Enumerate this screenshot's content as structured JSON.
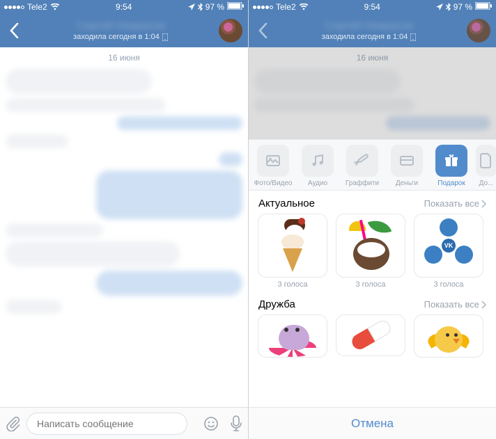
{
  "status": {
    "carrier": "Tele2",
    "time": "9:54",
    "battery": "97 %"
  },
  "header": {
    "name": "Сергей Некрасов",
    "last_seen": "заходила сегодня в 1:04"
  },
  "chat": {
    "date_separator": "16 июня",
    "compose_placeholder": "Написать сообщение"
  },
  "attachments": {
    "items": [
      {
        "key": "photo",
        "label": "Фото/Видео"
      },
      {
        "key": "audio",
        "label": "Аудио"
      },
      {
        "key": "graffiti",
        "label": "Граффити"
      },
      {
        "key": "money",
        "label": "Деньги"
      },
      {
        "key": "gift",
        "label": "Подарок"
      },
      {
        "key": "doc",
        "label": "До..."
      }
    ]
  },
  "gifts": {
    "sections": [
      {
        "title": "Актуальное",
        "show_all": "Показать все",
        "items": [
          {
            "name": "ice-cream",
            "price": "3 голоса"
          },
          {
            "name": "coconut",
            "price": "3 голоса"
          },
          {
            "name": "spinner",
            "price": "3 голоса"
          }
        ]
      },
      {
        "title": "Дружба",
        "show_all": "Показать все",
        "items": [
          {
            "name": "hippo",
            "price": ""
          },
          {
            "name": "pill",
            "price": ""
          },
          {
            "name": "chick",
            "price": ""
          }
        ]
      }
    ],
    "cancel": "Отмена"
  },
  "colors": {
    "vk_blue": "#5181B8",
    "accent": "#528bcc"
  }
}
